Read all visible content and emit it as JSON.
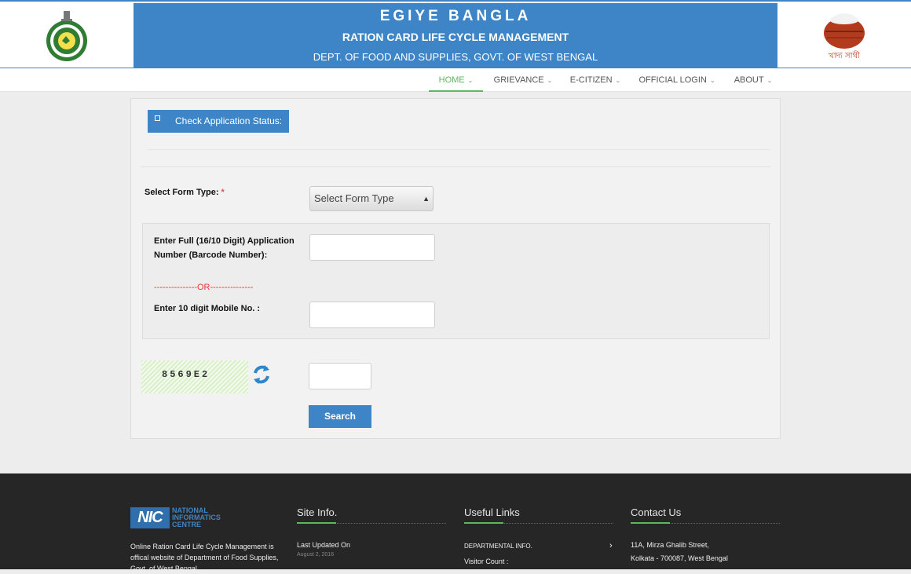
{
  "header": {
    "title": "EGIYE BANGLA",
    "subtitle": "RATION CARD LIFE CYCLE MANAGEMENT",
    "department": "DEPT. OF FOOD AND SUPPLIES, GOVT. OF WEST BENGAL",
    "right_logo_text": "খাদ্য সাথী"
  },
  "nav": {
    "items": [
      {
        "label": "HOME"
      },
      {
        "label": "GRIEVANCE"
      },
      {
        "label": "E-CITIZEN"
      },
      {
        "label": "OFFICIAL LOGIN"
      },
      {
        "label": "ABOUT"
      }
    ],
    "active_color": "#5cb85c"
  },
  "form": {
    "tab_label": "Check Application Status:",
    "form_type_label": "Select Form Type:",
    "required_mark": "*",
    "form_type_selected": "Select Form Type",
    "application_number_label": "Enter Full (16/10 Digit) Application Number (Barcode Number):",
    "or_separator": "---------------OR---------------",
    "mobile_label": "Enter 10 digit Mobile No. :",
    "captcha_text": "8569E2",
    "search_label": "Search"
  },
  "footer": {
    "nic_abbr": "NIC",
    "nic_name_line1": "NATIONAL",
    "nic_name_line2": "INFORMATICS",
    "nic_name_line3": "CENTRE",
    "about_text": "Online Ration Card Life Cycle Management is offical website of Department of Food Supplies, Govt. of West Bengal",
    "site_info_title": "Site Info.",
    "last_updated_label": "Last Updated On",
    "last_updated_date": "August 2, 2016",
    "useful_links_title": "Useful Links",
    "departmental_info": "DEPARTMENTAL INFO.",
    "visitor_count_label": "Visitor Count :",
    "contact_title": "Contact Us",
    "address_line1": "11A, Mirza Ghalib Street,",
    "address_line2": "Kolkata - 700087, West Bengal"
  },
  "colors": {
    "brand_blue": "#3d85c6",
    "accent_green": "#5cb85c",
    "footer_bg": "#262626",
    "error_red": "#e33333"
  },
  "icons": {
    "left_logo": "biswa-bangla-emblem-icon",
    "right_logo": "khadya-sathi-pot-icon",
    "refresh": "refresh-icon",
    "nav_chevron": "chevron-down-icon",
    "link_chevron": "chevron-right-icon"
  }
}
